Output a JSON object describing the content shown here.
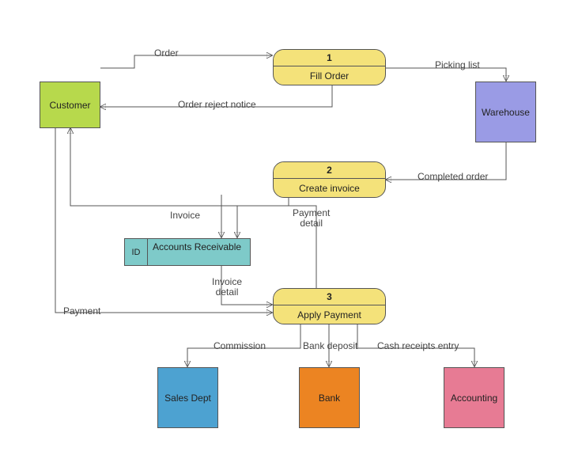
{
  "entities": {
    "customer": {
      "label": "Customer",
      "fill": "#b7d94c"
    },
    "warehouse": {
      "label": "Warehouse",
      "fill": "#9a9be5"
    },
    "sales_dept": {
      "label": "Sales Dept",
      "fill": "#4da2d1"
    },
    "bank": {
      "label": "Bank",
      "fill": "#ec8422"
    },
    "accounting": {
      "label": "Accounting",
      "fill": "#e77b94"
    }
  },
  "processes": {
    "p1": {
      "number": "1",
      "label": "Fill Order"
    },
    "p2": {
      "number": "2",
      "label": "Create invoice"
    },
    "p3": {
      "number": "3",
      "label": "Apply Payment"
    }
  },
  "datastore": {
    "ar": {
      "id": "ID",
      "label": "Accounts Receivable"
    }
  },
  "flows": {
    "order": "Order",
    "picking_list": "Picking list",
    "order_reject": "Order reject notice",
    "completed_order": "Completed order",
    "invoice": "Invoice",
    "invoice_detail": "Invoice\ndetail",
    "payment_detail": "Payment\ndetail",
    "payment": "Payment",
    "commission": "Commission",
    "bank_deposit": "Bank deposit",
    "cash_receipts": "Cash receipts entry"
  }
}
